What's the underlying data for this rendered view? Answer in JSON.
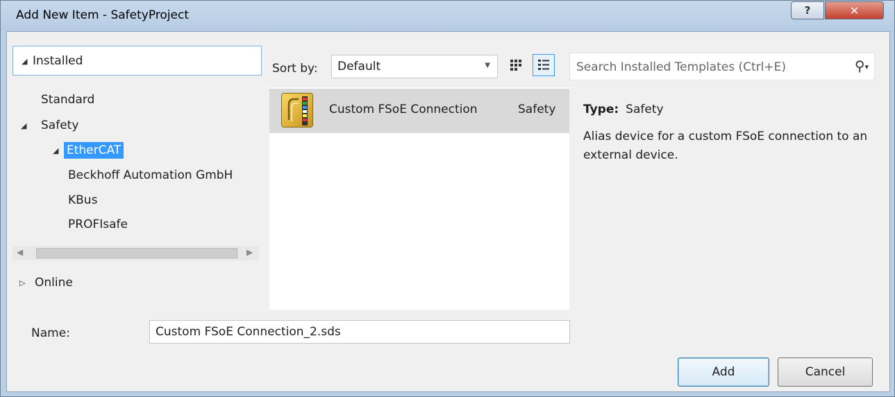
{
  "window": {
    "title": "Add New Item - SafetyProject",
    "help_label": "?",
    "close_label": "✕"
  },
  "tree": {
    "installed": "Installed",
    "items": [
      {
        "label": "Standard"
      },
      {
        "label": "Safety"
      },
      {
        "label": "EtherCAT"
      },
      {
        "label": "Beckhoff Automation GmbH"
      },
      {
        "label": "KBus"
      },
      {
        "label": "PROFIsafe"
      }
    ],
    "online": "Online"
  },
  "toolbar": {
    "sort_label": "Sort by:",
    "sort_value": "Default"
  },
  "search": {
    "placeholder": "Search Installed Templates (Ctrl+E)"
  },
  "templates": [
    {
      "name": "Custom FSoE Connection",
      "category": "Safety"
    }
  ],
  "details": {
    "type_label": "Type:",
    "type_value": "Safety",
    "description": "Alias device for a custom FSoE connection to an external device."
  },
  "form": {
    "name_label": "Name:",
    "name_value": "Custom FSoE Connection_2.sds"
  },
  "buttons": {
    "add": "Add",
    "cancel": "Cancel"
  },
  "colors": {
    "selection": "#3399ff",
    "close_button": "#c4402d",
    "titlebar": "#b9cfe6"
  }
}
